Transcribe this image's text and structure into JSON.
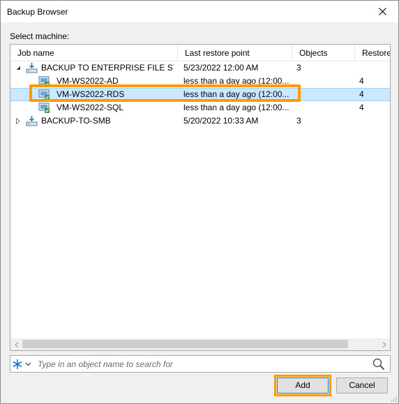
{
  "window": {
    "title": "Backup Browser",
    "close_icon": "close-icon"
  },
  "select_label": "Select machine:",
  "columns": [
    "Job name",
    "Last restore point",
    "Objects",
    "Restore"
  ],
  "rows": [
    {
      "level": 0,
      "expanded": true,
      "name": "BACKUP TO ENTERPRISE FILE ST...",
      "restore_point": "5/23/2022 12:00 AM",
      "objects": "3",
      "restore": "",
      "icon": "backup-job-icon"
    },
    {
      "level": 1,
      "name": "VM-WS2022-AD",
      "restore_point": "less than a day ago (12:00...",
      "objects": "",
      "restore": "4",
      "icon": "vm-icon"
    },
    {
      "level": 1,
      "selected": true,
      "name": "VM-WS2022-RDS",
      "restore_point": "less than a day ago (12:00...",
      "objects": "",
      "restore": "4",
      "icon": "vm-icon"
    },
    {
      "level": 1,
      "name": "VM-WS2022-SQL",
      "restore_point": "less than a day ago (12:00...",
      "objects": "",
      "restore": "4",
      "icon": "vm-icon"
    },
    {
      "level": 0,
      "expanded": false,
      "name": "BACKUP-TO-SMB",
      "restore_point": "5/20/2022 10:33 AM",
      "objects": "3",
      "restore": "",
      "icon": "backup-job-icon"
    }
  ],
  "search": {
    "placeholder": "Type in an object name to search for"
  },
  "buttons": {
    "add": "Add",
    "cancel": "Cancel"
  },
  "colors": {
    "selection": "#cce8ff",
    "highlight": "#ff9900",
    "accent": "#0078d7"
  }
}
